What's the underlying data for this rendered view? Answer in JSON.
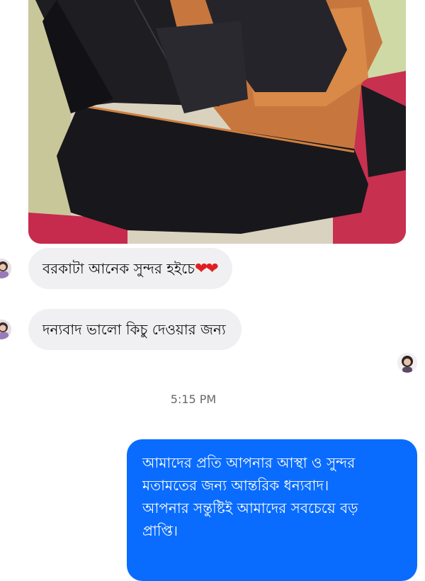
{
  "conversation": {
    "attachment": {
      "type": "image",
      "subject": "black-and-orange-clothes"
    },
    "messages": [
      {
        "sender": "contact",
        "text": "বরকাটা আনেক সুন্দর  হইচে",
        "emoji": "❤❤"
      },
      {
        "sender": "contact",
        "text": "দন্যবাদ ভালো  কিচু দেওয়ার জন্য"
      }
    ],
    "timestamp": "5:15 PM",
    "reply": {
      "sender": "me",
      "lines": [
        "আমাদের প্রতি আপনার আস্থা ও সুন্দর",
        "মতামতের জন্য আন্তরিক ধন্যবাদ।",
        "আপনার সন্তুষ্টিই আমাদের সবচেয়ে বড়",
        "প্রাপ্তি।"
      ]
    }
  },
  "colors": {
    "outgoing_bubble": "#0a6cff",
    "incoming_bubble": "#f0f0f2",
    "timestamp": "#65676b",
    "heart": "#e02020"
  },
  "icons": [
    "contact-avatar",
    "read-receipt-avatar"
  ]
}
